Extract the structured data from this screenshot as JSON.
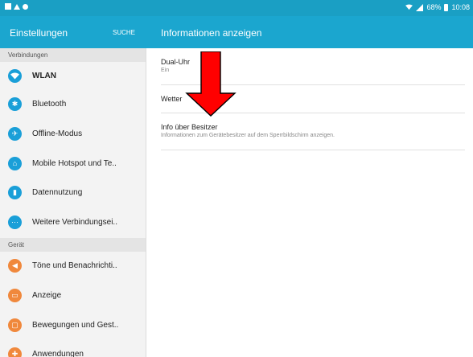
{
  "status_bar": {
    "battery_percent": "68%",
    "time": "10:08"
  },
  "sidebar": {
    "title": "Einstellungen",
    "search_label": "SUCHE",
    "sections": [
      {
        "label": "Verbindungen",
        "items": [
          {
            "label": "WLAN",
            "icon": "wifi-icon",
            "color": "#1a9fd8"
          },
          {
            "label": "Bluetooth",
            "icon": "bluetooth-icon",
            "color": "#1a9fd8"
          },
          {
            "label": "Offline-Modus",
            "icon": "airplane-icon",
            "color": "#1a9fd8"
          },
          {
            "label": "Mobile Hotspot und Te..",
            "icon": "hotspot-icon",
            "color": "#1a9fd8"
          },
          {
            "label": "Datennutzung",
            "icon": "data-usage-icon",
            "color": "#1a9fd8"
          },
          {
            "label": "Weitere Verbindungsei..",
            "icon": "more-connections-icon",
            "color": "#1a9fd8"
          }
        ]
      },
      {
        "label": "Gerät",
        "items": [
          {
            "label": "Töne und Benachrichti..",
            "icon": "sound-icon",
            "color": "#f0883c"
          },
          {
            "label": "Anzeige",
            "icon": "display-icon",
            "color": "#f0883c"
          },
          {
            "label": "Bewegungen und Gest..",
            "icon": "motion-icon",
            "color": "#f0883c"
          },
          {
            "label": "Anwendungen",
            "icon": "apps-icon",
            "color": "#f0883c"
          }
        ]
      }
    ]
  },
  "content": {
    "title": "Informationen anzeigen",
    "items": [
      {
        "label": "Dual-Uhr",
        "sub": "Ein"
      },
      {
        "label": "Wetter",
        "sub": ""
      },
      {
        "label": "Info über Besitzer",
        "sub": "Informationen zum Gerätebesitzer auf dem Sperrbildschirm anzeigen."
      }
    ]
  },
  "colors": {
    "header": "#1ba6cf",
    "statusbar": "#1a9fc4",
    "arrow": "#ff0000"
  }
}
